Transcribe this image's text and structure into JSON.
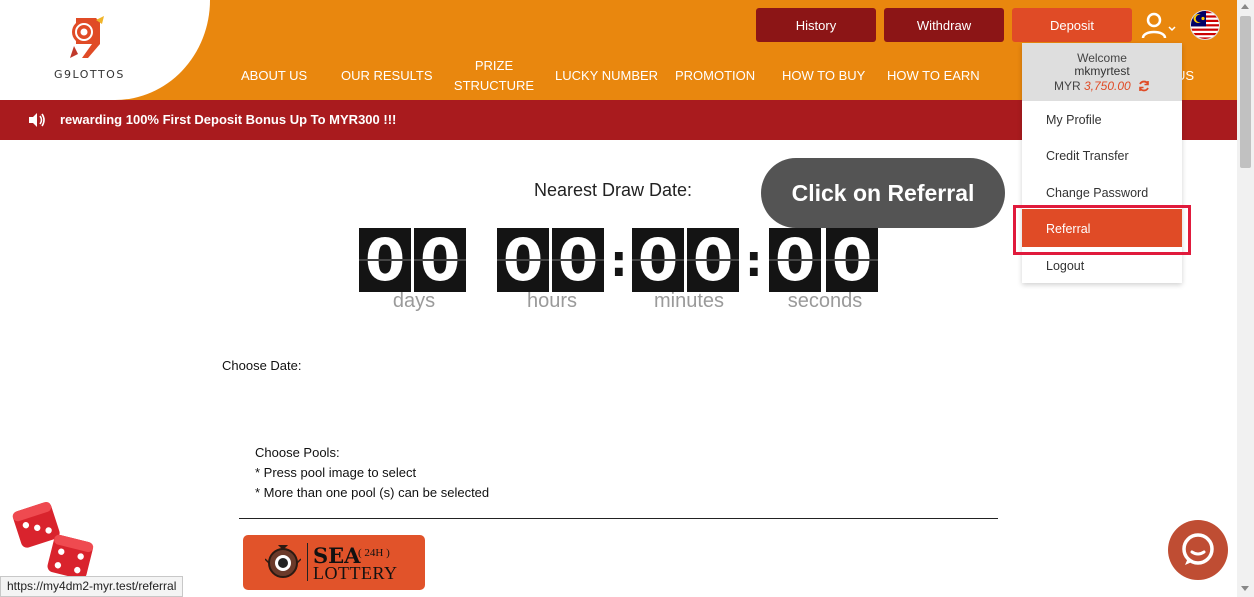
{
  "header": {
    "logo_text": "G9LOTTOS",
    "buttons": {
      "history": "History",
      "withdraw": "Withdraw",
      "deposit": "Deposit"
    },
    "nav": {
      "about": "ABOUT US",
      "results": "OUR RESULTS",
      "prize_line1": "PRIZE",
      "prize_line2": "STRUCTURE",
      "lucky": "LUCKY NUMBER",
      "promotion": "PROMOTION",
      "how_to_buy": "HOW TO BUY",
      "how_to_earn": "HOW TO EARN",
      "partial": "US"
    }
  },
  "marquee": {
    "text": "rewarding 100% First Deposit Bonus Up To MYR300 !!!"
  },
  "countdown": {
    "title": "Nearest Draw Date:",
    "days": [
      "0",
      "0"
    ],
    "hours": [
      "0",
      "0"
    ],
    "minutes": [
      "0",
      "0"
    ],
    "seconds": [
      "0",
      "0"
    ],
    "labels": {
      "days": "days",
      "hours": "hours",
      "minutes": "minutes",
      "seconds": "seconds"
    }
  },
  "content": {
    "choose_date": "Choose Date:",
    "pools_title": "Choose Pools:",
    "pools_note1": "* Press pool image to select",
    "pools_note2": "* More than one pool (s) can be selected",
    "pool_sea_line1": "SEA",
    "pool_sea_line2": "LOTTERY",
    "pool_sea_tag": "( 24H )"
  },
  "dropdown": {
    "welcome": "Welcome",
    "username": "mkmyrtest",
    "currency": "MYR",
    "balance": "3,750.00",
    "items": {
      "profile": "My Profile",
      "credit_transfer": "Credit Transfer",
      "change_password": "Change Password",
      "referral": "Referral",
      "logout": "Logout"
    }
  },
  "callout": {
    "text": "Click on Referral"
  },
  "status_bar": {
    "url": "https://my4dm2-myr.test/referral"
  },
  "colors": {
    "header_orange": "#e9870e",
    "dark_red": "#8c1516",
    "accent": "#e04b26",
    "marquee_red": "#a91b1e",
    "highlight": "#e01a3c"
  },
  "icons": [
    "user-icon",
    "flag-icon",
    "speaker-icon",
    "refresh-icon",
    "chat-icon",
    "dice-icon",
    "scroll-up-icon",
    "scroll-down-icon"
  ]
}
